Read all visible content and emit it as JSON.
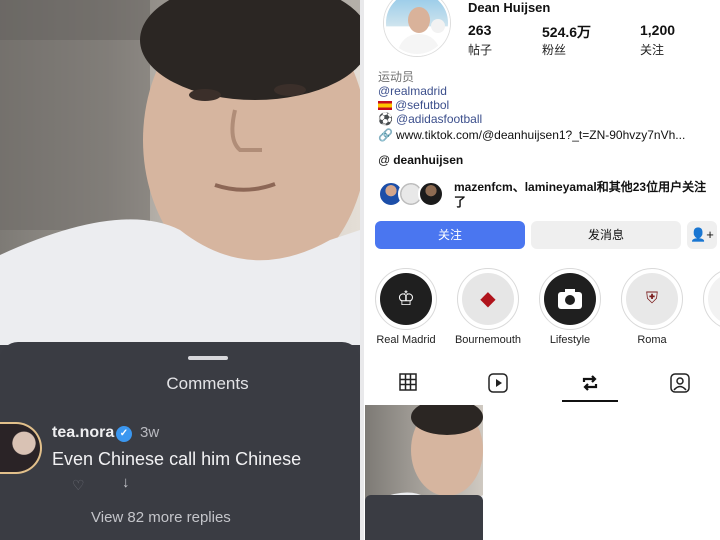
{
  "comments_panel": {
    "title": "Comments",
    "comment": {
      "username": "tea.nora",
      "time": "3w",
      "text": "Even Chinese call him Chinese"
    },
    "view_replies": "View 82 more replies"
  },
  "profile": {
    "name": "Dean Huijsen",
    "stats": [
      {
        "value": "263",
        "label": "帖子"
      },
      {
        "value": "524.6万",
        "label": "粉丝"
      },
      {
        "value": "1,200",
        "label": "关注"
      }
    ],
    "category": "运动员",
    "bio_mentions": [
      "@realmadrid",
      "@sefutbol",
      "@adidasfootball"
    ],
    "link": "www.tiktok.com/@deanhuijsen1?_t=ZN-90hvzy7nVh...",
    "threads_handle": "deanhuijsen",
    "followed_by": "mazenfcm、lamineyamal和其他23位用户关注了",
    "buttons": {
      "follow": "关注",
      "message": "发消息",
      "add_user": "+"
    },
    "highlights": [
      "Real Madrid",
      "Bournemouth",
      "Lifestyle",
      "Roma"
    ]
  },
  "colors": {
    "follow_button": "#4a76f0",
    "link_blue": "#3c4f8c",
    "comment_sheet": "#3a3c43",
    "verified_badge": "#3b97f0"
  }
}
